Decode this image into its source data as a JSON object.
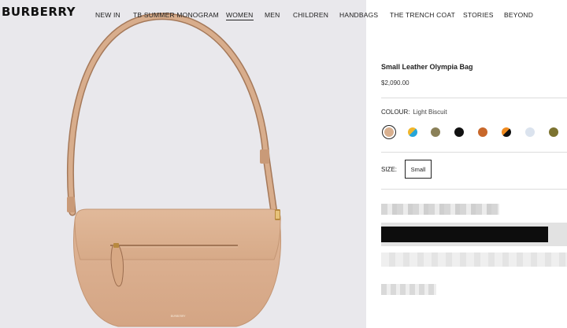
{
  "header": {
    "logo": "BURBERRY",
    "nav": [
      {
        "label": "NEW IN",
        "active": false
      },
      {
        "label": "TB SUMMER MONOGRAM",
        "active": false
      },
      {
        "label": "WOMEN",
        "active": true
      },
      {
        "label": "MEN",
        "active": false
      },
      {
        "label": "CHILDREN",
        "active": false
      },
      {
        "label": "HANDBAGS",
        "active": false
      },
      {
        "label": "THE TRENCH COAT",
        "active": false
      },
      {
        "label": "STORIES",
        "active": false
      },
      {
        "label": "BEYOND",
        "active": false
      }
    ]
  },
  "product": {
    "title": "Small Leather Olympia Bag",
    "price": "$2,090.00",
    "colour_label": "COLOUR:",
    "colour_value": "Light Biscuit",
    "swatches": [
      {
        "name": "light-biscuit",
        "colors": [
          "#d9b08f"
        ],
        "selected": true
      },
      {
        "name": "blue-yellow",
        "colors": [
          "#f0b62c",
          "#27a6d9"
        ],
        "selected": false
      },
      {
        "name": "olive",
        "colors": [
          "#8a8058"
        ],
        "selected": false
      },
      {
        "name": "black",
        "colors": [
          "#111111"
        ],
        "selected": false
      },
      {
        "name": "tan",
        "colors": [
          "#c8672a"
        ],
        "selected": false
      },
      {
        "name": "black-orange",
        "colors": [
          "#f08b1f",
          "#111111"
        ],
        "selected": false
      },
      {
        "name": "pale-blue",
        "colors": [
          "#dbe3ee"
        ],
        "selected": false
      },
      {
        "name": "khaki",
        "colors": [
          "#7c7330"
        ],
        "selected": false
      }
    ],
    "size_label": "SIZE:",
    "size_option": "Small"
  }
}
